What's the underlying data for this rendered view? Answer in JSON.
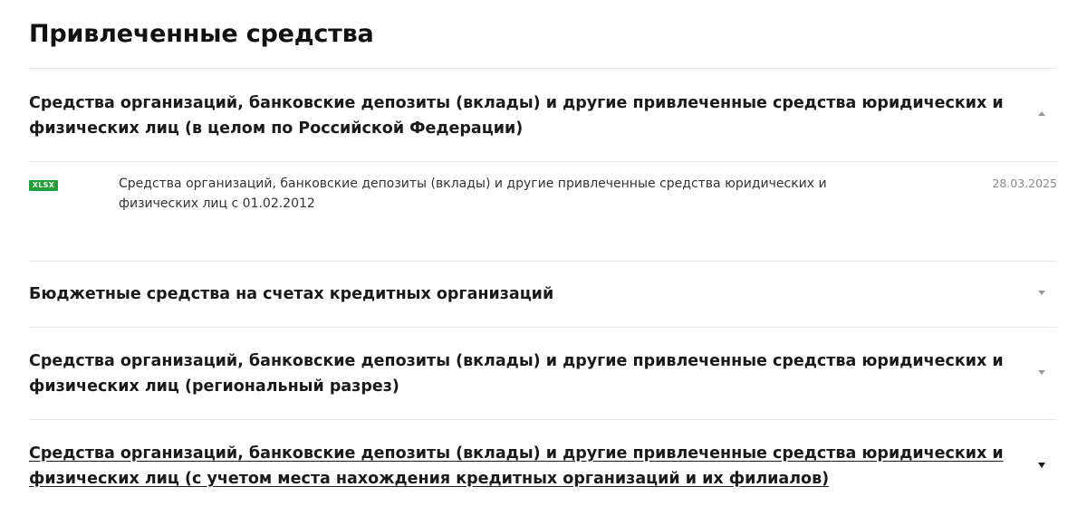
{
  "page": {
    "title": "Привлеченные средства"
  },
  "sections": [
    {
      "title": "Средства организаций, банковские депозиты (вклады) и другие привлеченные средства юридических и физических лиц (в целом по Российской Федерации)",
      "state": "expanded",
      "files": [
        {
          "format": "XLSX",
          "name": "Средства организаций, банковские депозиты (вклады) и другие привлеченные средства юридических и физических лиц с 01.02.2012",
          "date": "28.03.2025"
        }
      ]
    },
    {
      "title": "Бюджетные средства на счетах кредитных организаций",
      "state": "collapsed"
    },
    {
      "title": "Средства организаций, банковские депозиты (вклады) и другие привлеченные средства юридических и физических лиц (региональный разрез)",
      "state": "collapsed"
    },
    {
      "title": "Средства организаций, банковские депозиты (вклады) и другие привлеченные средства юридических и физических лиц (с учетом места нахождения кредитных организаций и их филиалов)",
      "state": "collapsed-hover"
    }
  ],
  "colors": {
    "badge_xlsx": "#21a038",
    "divider": "#e6e6e6",
    "caret": "#9a9a9a"
  },
  "icons": {
    "expanded": "caret-up-icon",
    "collapsed": "caret-down-icon"
  }
}
